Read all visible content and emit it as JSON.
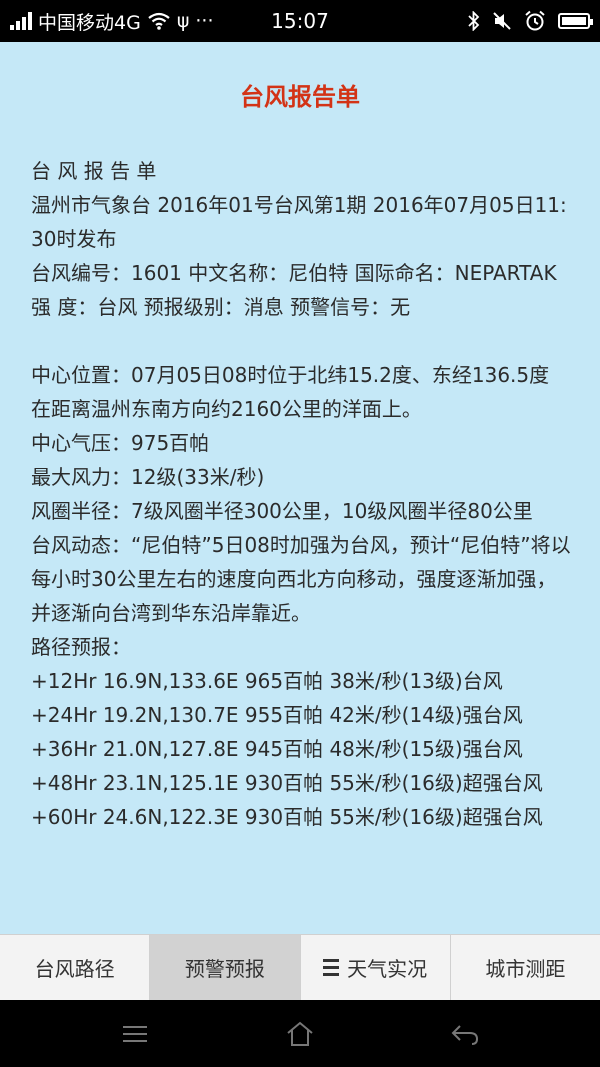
{
  "status_bar": {
    "carrier": "中国移动4G",
    "extra": "ψ ···",
    "time": "15:07"
  },
  "page": {
    "title": "台风报告单"
  },
  "report": {
    "lines": [
      "台 风 报 告 单",
      "温州市气象台 2016年01号台风第1期 2016年07月05日11:30时发布",
      "台风编号：1601 中文名称：尼伯特 国际命名：NEPARTAK",
      "强 度：台风 预报级别：消息 预警信号：无",
      "",
      "中心位置：07月05日08时位于北纬15.2度、东经136.5度",
      "在距离温州东南方向约2160公里的洋面上。",
      "中心气压：975百帕",
      "最大风力：12级(33米/秒)",
      "风圈半径：7级风圈半径300公里，10级风圈半径80公里",
      "台风动态：“尼伯特”5日08时加强为台风，预计“尼伯特”将以每小时30公里左右的速度向西北方向移动，强度逐渐加强，并逐渐向台湾到华东沿岸靠近。",
      "路径预报：",
      "+12Hr 16.9N,133.6E 965百帕 38米/秒(13级)台风",
      "+24Hr 19.2N,130.7E 955百帕 42米/秒(14级)强台风",
      "+36Hr 21.0N,127.8E 945百帕 48米/秒(15级)强台风",
      "+48Hr 23.1N,125.1E 930百帕 55米/秒(16级)超强台风",
      "+60Hr 24.6N,122.3E 930百帕 55米/秒(16级)超强台风"
    ]
  },
  "tabs": [
    {
      "label": "台风路径",
      "active": false
    },
    {
      "label": "预警预报",
      "active": true
    },
    {
      "label": "天气实况",
      "active": false
    },
    {
      "label": "城市测距",
      "active": false
    }
  ],
  "icons": {
    "signal": "signal-icon",
    "wifi": "wifi-icon",
    "bluetooth": "bluetooth-icon",
    "mute": "mute-icon",
    "alarm": "alarm-icon",
    "battery": "battery-icon",
    "menu": "menu-icon",
    "home": "home-icon",
    "back": "back-icon"
  },
  "colors": {
    "title": "#d33316",
    "background": "#c5e8f7",
    "active_tab": "#d2d2d2"
  }
}
